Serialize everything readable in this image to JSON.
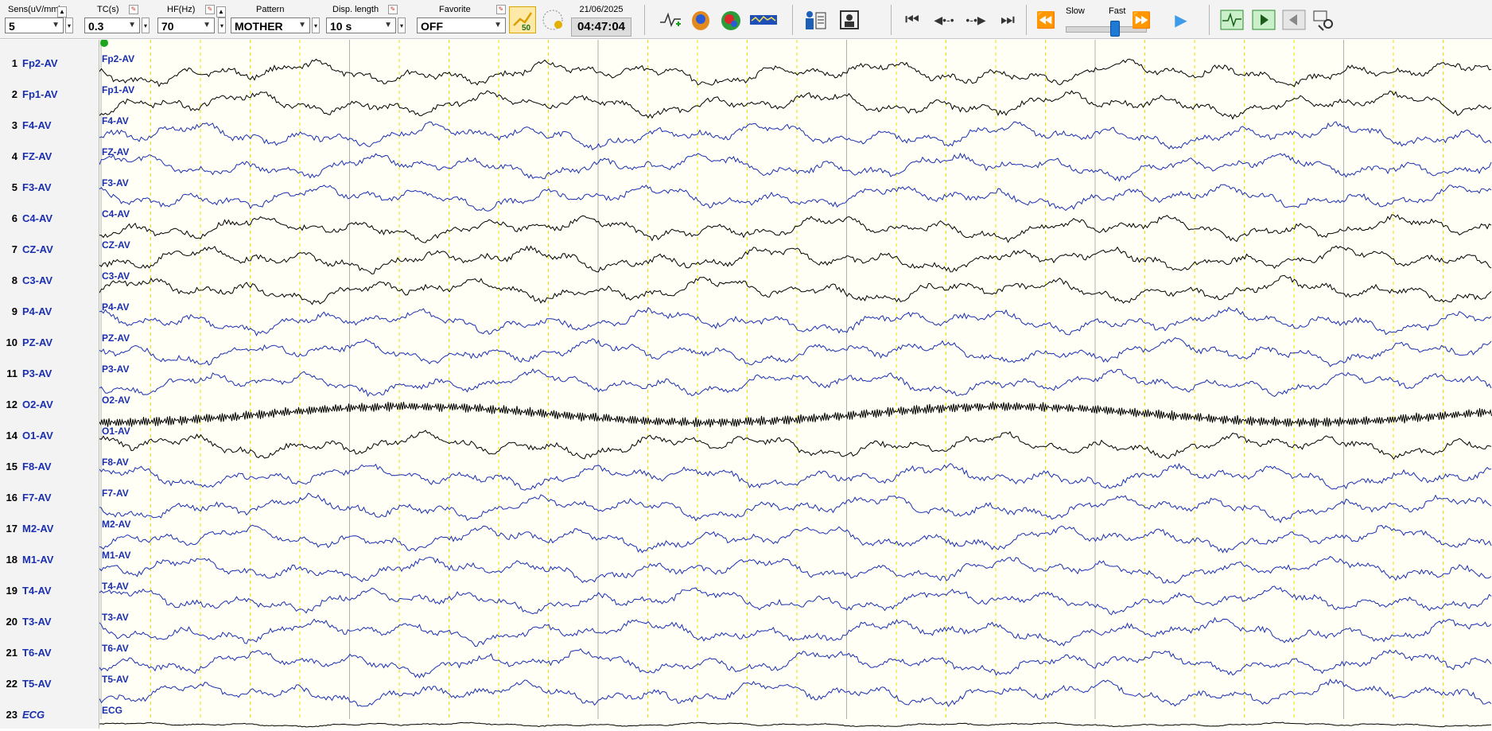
{
  "toolbar": {
    "sens": {
      "label": "Sens(uV/mm)",
      "value": "5"
    },
    "tc": {
      "label": "TC(s)",
      "value": "0.3"
    },
    "hf": {
      "label": "HF(Hz)",
      "value": "70"
    },
    "pattern": {
      "label": "Pattern",
      "value": "MOTHER"
    },
    "disp_length": {
      "label": "Disp. length",
      "value": "10 s"
    },
    "favorite": {
      "label": "Favorite",
      "value": "OFF"
    },
    "date": "21/06/2025",
    "time": "04:47:04",
    "speed": {
      "slow": "Slow",
      "fast": "Fast"
    },
    "filter_badge": "50"
  },
  "channels": [
    {
      "num": "1",
      "name": "Fp2-AV",
      "trace": "Fp2-AV",
      "color": "#000000"
    },
    {
      "num": "2",
      "name": "Fp1-AV",
      "trace": "Fp1-AV",
      "color": "#000000"
    },
    {
      "num": "3",
      "name": "F4-AV",
      "trace": "F4-AV",
      "color": "#1a2fb0"
    },
    {
      "num": "4",
      "name": "FZ-AV",
      "trace": "FZ-AV",
      "color": "#1a2fb0"
    },
    {
      "num": "5",
      "name": "F3-AV",
      "trace": "F3-AV",
      "color": "#1a2fb0"
    },
    {
      "num": "6",
      "name": "C4-AV",
      "trace": "C4-AV",
      "color": "#000000"
    },
    {
      "num": "7",
      "name": "CZ-AV",
      "trace": "CZ-AV",
      "color": "#000000"
    },
    {
      "num": "8",
      "name": "C3-AV",
      "trace": "C3-AV",
      "color": "#000000"
    },
    {
      "num": "9",
      "name": "P4-AV",
      "trace": "P4-AV",
      "color": "#1a2fb0"
    },
    {
      "num": "10",
      "name": "PZ-AV",
      "trace": "PZ-AV",
      "color": "#1a2fb0"
    },
    {
      "num": "11",
      "name": "P3-AV",
      "trace": "P3-AV",
      "color": "#1a2fb0"
    },
    {
      "num": "12",
      "name": "O2-AV",
      "trace": "O2-AV",
      "color": "#000000"
    },
    {
      "num": "14",
      "name": "O1-AV",
      "trace": "O1-AV",
      "color": "#000000"
    },
    {
      "num": "15",
      "name": "F8-AV",
      "trace": "F8-AV",
      "color": "#1a2fb0"
    },
    {
      "num": "16",
      "name": "F7-AV",
      "trace": "F7-AV",
      "color": "#1a2fb0"
    },
    {
      "num": "17",
      "name": "M2-AV",
      "trace": "M2-AV",
      "color": "#1a2fb0"
    },
    {
      "num": "18",
      "name": "M1-AV",
      "trace": "M1-AV",
      "color": "#1a2fb0"
    },
    {
      "num": "19",
      "name": "T4-AV",
      "trace": "T4-AV",
      "color": "#1a2fb0"
    },
    {
      "num": "20",
      "name": "T3-AV",
      "trace": "T3-AV",
      "color": "#1a2fb0"
    },
    {
      "num": "21",
      "name": "T6-AV",
      "trace": "T6-AV",
      "color": "#1a2fb0"
    },
    {
      "num": "22",
      "name": "T5-AV",
      "trace": "T5-AV",
      "color": "#1a2fb0"
    },
    {
      "num": "23",
      "name": "ECG",
      "trace": "ECG",
      "color": "#000000"
    }
  ],
  "colors": {
    "trace_blue": "#1a2fb0",
    "grid_yellow": "#e8e000",
    "grid_gray": "#b0b0b0",
    "background": "#fffff5"
  }
}
